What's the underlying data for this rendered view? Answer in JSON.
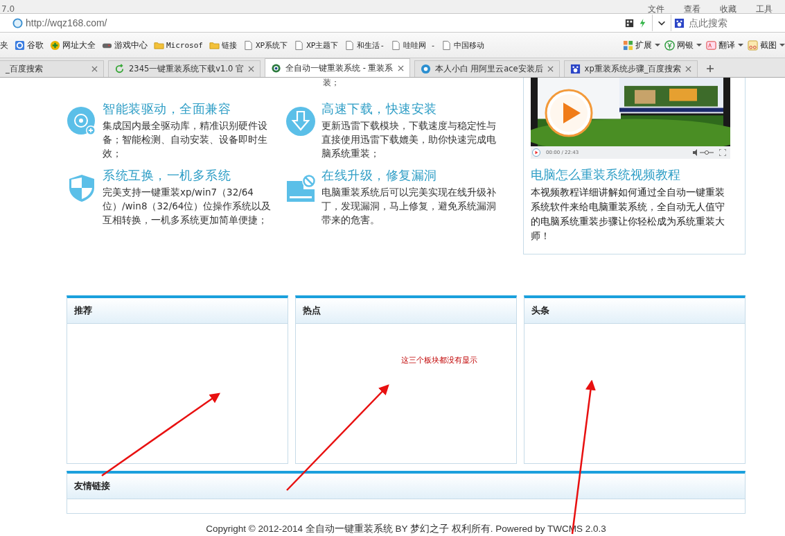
{
  "browser": {
    "version": "7.0",
    "menu": [
      "文件",
      "查看",
      "收藏",
      "工具"
    ],
    "address": "http://wqz168.com/",
    "search_placeholder": "点此搜索",
    "bookmarks": [
      {
        "label": "夹",
        "kind": "plain"
      },
      {
        "label": "谷歌",
        "kind": "google"
      },
      {
        "label": "网址大全",
        "kind": "plus"
      },
      {
        "label": "游戏中心",
        "kind": "gamepad"
      },
      {
        "label": "Microsof",
        "kind": "folder"
      },
      {
        "label": "链接",
        "kind": "folder"
      },
      {
        "label": "XP系统下",
        "kind": "page"
      },
      {
        "label": "XP主题下",
        "kind": "page"
      },
      {
        "label": "和生活-",
        "kind": "page"
      },
      {
        "label": "哇哇网 -",
        "kind": "page"
      },
      {
        "label": "中国移动",
        "kind": "page"
      }
    ],
    "tools": [
      {
        "label": "扩展",
        "kind": "grid"
      },
      {
        "label": "网银",
        "kind": "yen"
      },
      {
        "label": "翻译",
        "kind": "translate"
      },
      {
        "label": "截图",
        "kind": "scissors"
      }
    ],
    "tabs": [
      {
        "label": "_百度搜索",
        "kind": "plain",
        "selected": false
      },
      {
        "label": "2345一键重装系统下载v1.0 官",
        "kind": "refresh",
        "selected": false
      },
      {
        "label": "全自动一键重装系统 - 重装系",
        "kind": "globe",
        "selected": true
      },
      {
        "label": "本人小白 用阿里云ace安装后",
        "kind": "aperture",
        "selected": false
      },
      {
        "label": "xp重装系统步骤_百度搜索",
        "kind": "paw",
        "selected": false
      }
    ]
  },
  "page": {
    "cut_text": "装；",
    "features": [
      {
        "kind": "disc",
        "title": "智能装驱动，全面兼容",
        "text": "集成国内最全驱动库，精准识别硬件设备；智能检测、自动安装、设备即时生效；"
      },
      {
        "kind": "download",
        "title": "高速下载，快速安装",
        "text": "更新迅雷下载模块，下载速度与稳定性与直接使用迅雷下载媲美，助你快速完成电脑系统重装；"
      },
      {
        "kind": "shield",
        "title": "系统互换，一机多系统",
        "text": "完美支持一键重装xp/win7（32/64位）/win8（32/64位）位操作系统以及互相转换，一机多系统更加简单便捷；"
      },
      {
        "kind": "drive",
        "title": "在线升级，修复漏洞",
        "text": "电脑重装系统后可以完美实现在线升级补丁，发现漏洞，马上修复，避免系统漏洞带来的危害。"
      }
    ],
    "video": {
      "time": "00:00 / 22:43",
      "title": "电脑怎么重装系统视频教程",
      "text": "本视频教程详细讲解如何通过全自动一键重装系统软件来给电脑重装系统，全自动无人值守的电脑系统重装步骤让你轻松成为系统重装大师！"
    },
    "panels": [
      "推荐",
      "热点",
      "头条"
    ],
    "annotation": "这三个板块都没有显示",
    "links_panel": "友情链接",
    "footer": "Copyright © 2012-2014 全自动一键重装系统 BY 梦幻之子 权利所有. Powered by TWCMS 2.0.3"
  }
}
